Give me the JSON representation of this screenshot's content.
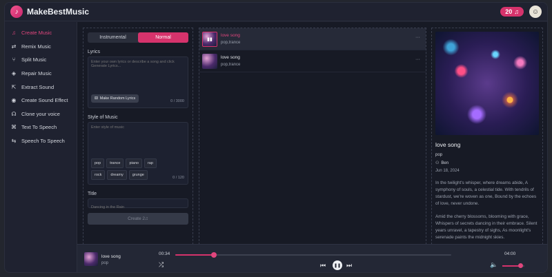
{
  "header": {
    "app_title": "MakeBestMusic",
    "credits": "20",
    "music_note": "♫"
  },
  "sidebar": {
    "items": [
      {
        "label": "Create Music",
        "icon": "music-note-icon",
        "active": true
      },
      {
        "label": "Remix Music",
        "icon": "remix-icon"
      },
      {
        "label": "Split Music",
        "icon": "split-icon"
      },
      {
        "label": "Repair Music",
        "icon": "repair-icon"
      },
      {
        "label": "Extract Sound",
        "icon": "extract-icon"
      },
      {
        "label": "Create Sound Effect",
        "icon": "sound-effect-icon"
      },
      {
        "label": "Clone your voice",
        "icon": "voice-clone-icon"
      },
      {
        "label": "Text To Speech",
        "icon": "text-to-speech-icon"
      },
      {
        "label": "Speech To Speech",
        "icon": "speech-to-speech-icon"
      }
    ]
  },
  "form": {
    "mode_instrumental": "Instrumental",
    "mode_normal": "Normal",
    "lyrics_label": "Lyrics",
    "lyrics_placeholder": "Enter your own lyrics or describe a song and click Generate Lyrics...",
    "random_lyrics_button": "Make Random Lyrics",
    "lyrics_counter": "0 / 3000",
    "style_label": "Style of Music",
    "style_placeholder": "Enter style of music",
    "style_counter": "0 / 120",
    "tags": [
      "pop",
      "trance",
      "piano",
      "rap",
      "rock",
      "dreamy",
      "grunge"
    ],
    "title_label": "Title",
    "title_placeholder": "Dancing in the Rain",
    "create_button": "Create 2♫"
  },
  "songs": [
    {
      "title": "love song",
      "genre": "pop,trance",
      "selected": true
    },
    {
      "title": "love song",
      "genre": "pop,trance",
      "selected": false
    }
  ],
  "detail": {
    "title": "love song",
    "genre": "pop",
    "author": "Ben",
    "date": "Jun 18, 2024",
    "lyrics_stanza_1": "In the twilight's whisper, where dreams abide, A symphony of souls, a celestial tide. With tendrils of stardust, we're woven as one, Bound by the echoes of love, never undone.",
    "lyrics_stanza_2": "Amid the cherry blossoms, blooming with grace, Whispers of secrets dancing in their embrace. Silent years unravel, a tapestry of sighs, As moonlight's serenade paints the midnight skies."
  },
  "player": {
    "title": "love song",
    "genre": "pop",
    "current_time": "00:34",
    "duration": "04:00",
    "progress": 0.14,
    "volume": 0.8
  }
}
